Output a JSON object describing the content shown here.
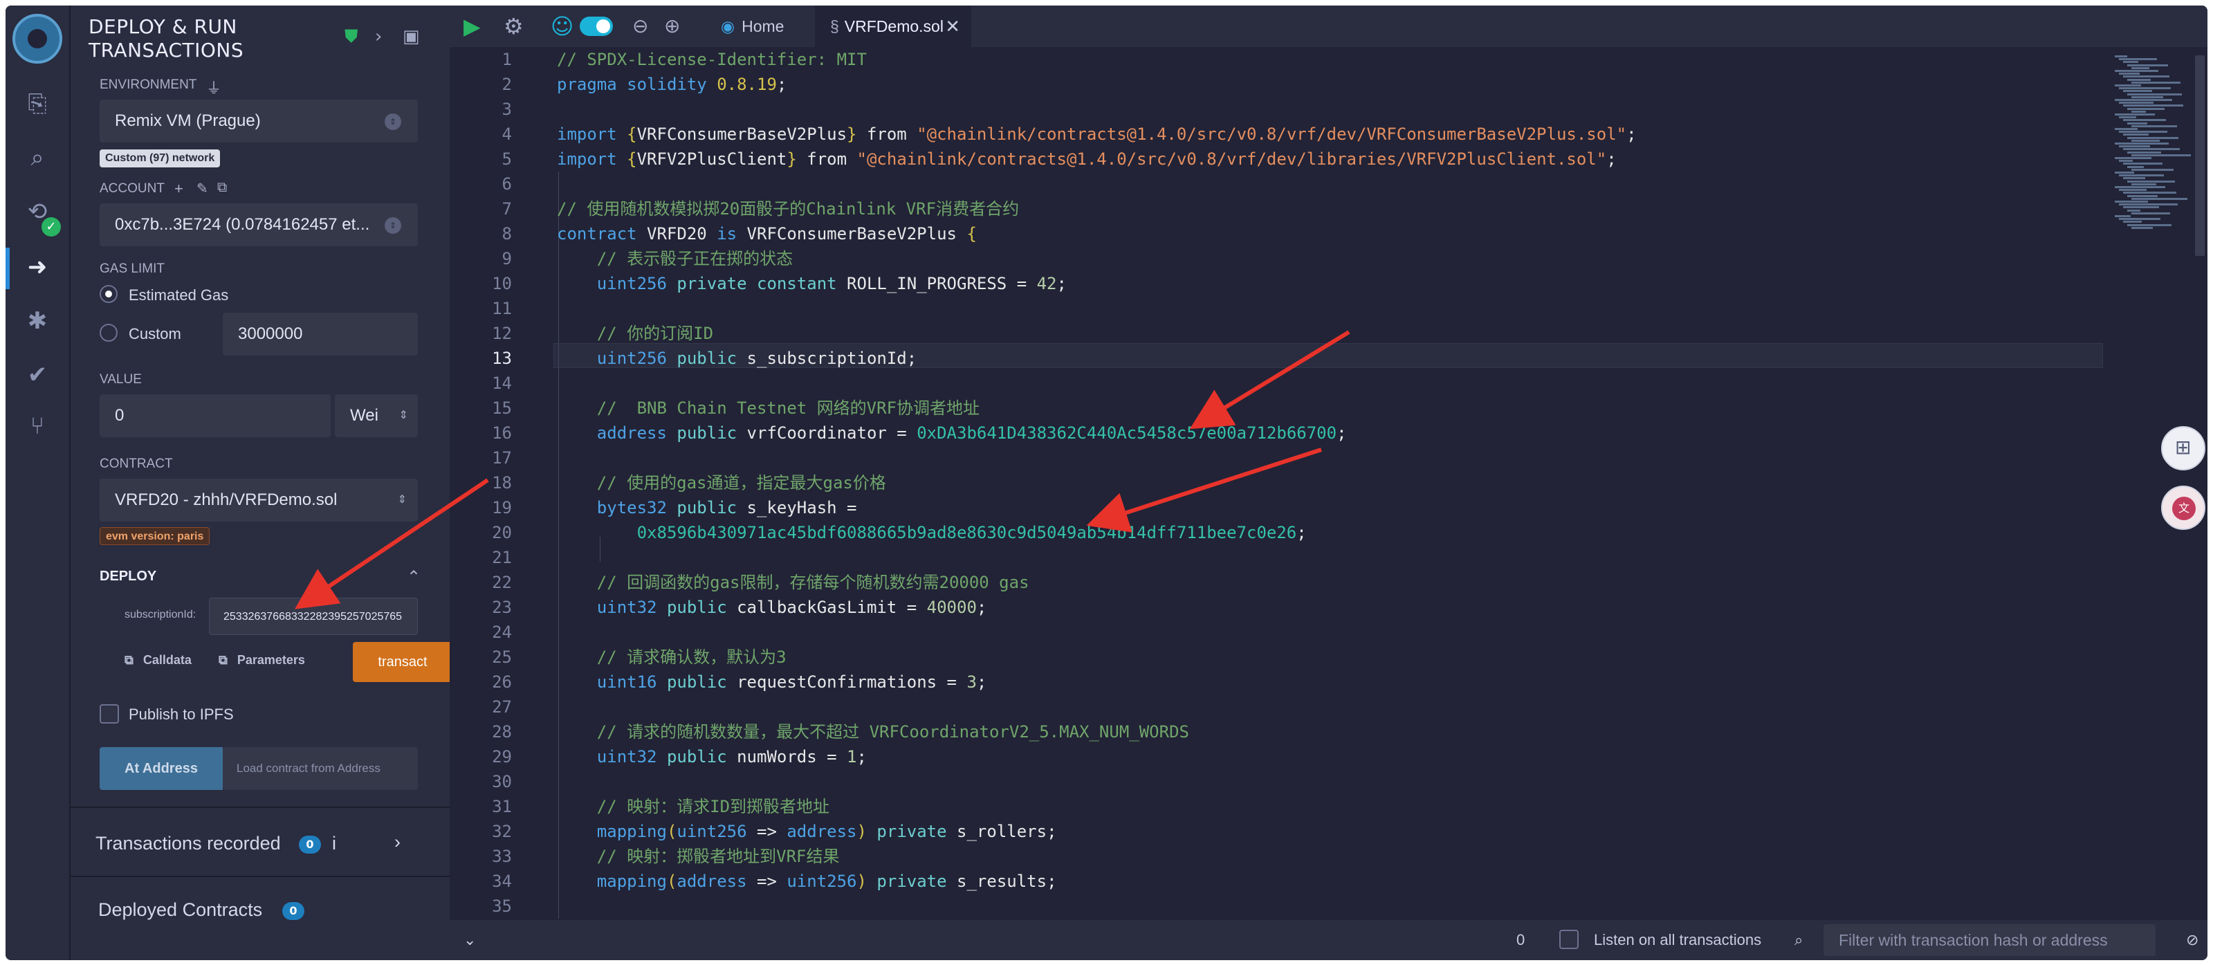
{
  "sidebar_icons": [
    "file-explorer-icon",
    "search-icon",
    "solidity-compiler-icon",
    "deploy-run-icon",
    "debugger-icon",
    "unit-test-icon",
    "git-icon"
  ],
  "panel": {
    "title_line1": "DEPLOY & RUN",
    "title_line2": "TRANSACTIONS",
    "environment_label": "ENVIRONMENT",
    "environment_value": "Remix VM (Prague)",
    "network_tag": "Custom (97) network",
    "account_label": "ACCOUNT",
    "account_value": "0xc7b...3E724 (0.0784162457 et...",
    "gas_limit_label": "GAS LIMIT",
    "gas_estimated": "Estimated Gas",
    "gas_custom": "Custom",
    "gas_custom_value": "3000000",
    "value_label": "VALUE",
    "value_amount": "0",
    "value_unit": "Wei",
    "contract_label": "CONTRACT",
    "contract_value": "VRFD20 - zhhh/VRFDemo.sol",
    "evm_tag": "evm version: paris",
    "deploy_label": "DEPLOY",
    "subscription_label": "subscriptionId:",
    "subscription_value": "25332637668332282395257025765",
    "calldata_label": "Calldata",
    "parameters_label": "Parameters",
    "transact_label": "transact",
    "publish_label": "Publish to IPFS",
    "at_address_label": "At Address",
    "load_contract_placeholder": "Load contract from Address",
    "transactions_recorded_label": "Transactions recorded",
    "transactions_recorded_count": "0",
    "info_label": "i",
    "deployed_contracts_label": "Deployed Contracts",
    "deployed_contracts_count": "0"
  },
  "tabs": {
    "home": "Home",
    "file": "VRFDemo.sol"
  },
  "editor": {
    "current_line": 13,
    "line_numbers": [
      "1",
      "2",
      "3",
      "4",
      "5",
      "6",
      "7",
      "8",
      "9",
      "10",
      "11",
      "12",
      "13",
      "14",
      "15",
      "16",
      "17",
      "18",
      "19",
      "20",
      "21",
      "22",
      "23",
      "24",
      "25",
      "26",
      "27",
      "28",
      "29",
      "30",
      "31",
      "32",
      "33",
      "34",
      "35"
    ]
  },
  "bottom": {
    "count": "0",
    "listen_label": "Listen on all transactions",
    "filter_placeholder": "Filter with transaction hash or address"
  }
}
